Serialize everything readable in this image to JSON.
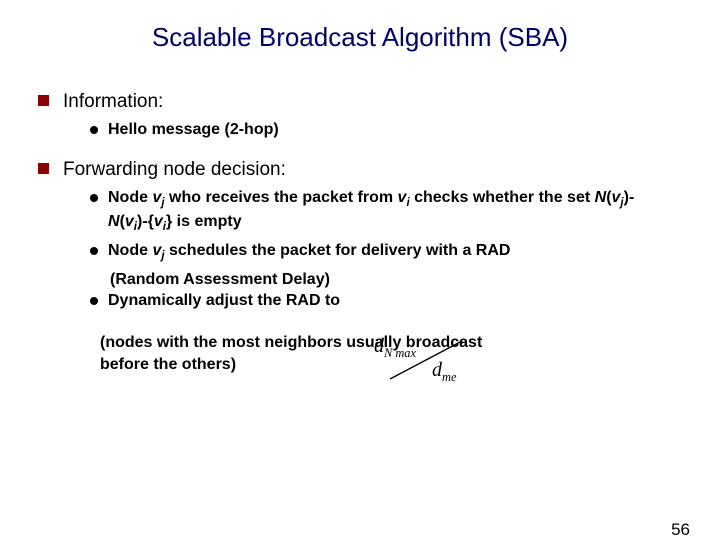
{
  "title": "Scalable Broadcast Algorithm (SBA)",
  "items": [
    {
      "label": "Information:",
      "sub": [
        {
          "html": "Hello message (2-hop)"
        }
      ]
    },
    {
      "label": "Forwarding node decision:",
      "sub": [
        {
          "html": "Node <span class='it'>v<span class='sub'>j</span></span> who receives the packet from <span class='it'>v<span class='sub'>i</span></span> checks whether the set <span class='it'>N</span>(<span class='it'>v<span class='sub'>j</span></span>)-<span class='it'>N</span>(<span class='it'>v<span class='sub'>i</span></span>)-{<span class='it'>v<span class='sub'>i</span></span>} is empty"
        },
        {
          "html": "Node <span class='it'>v<span class='sub'>j</span></span> schedules the packet for delivery with a RAD",
          "after": "(Random Assessment Delay)"
        },
        {
          "html": "Dynamically adjust the RAD to"
        }
      ]
    }
  ],
  "note_line1": "(nodes with the most neighbors usually broadcast",
  "note_line2": "before the others)",
  "formula": {
    "top": "d",
    "top_sub": "N max",
    "bot": "d",
    "bot_sub": "me"
  },
  "pagenum": "56"
}
